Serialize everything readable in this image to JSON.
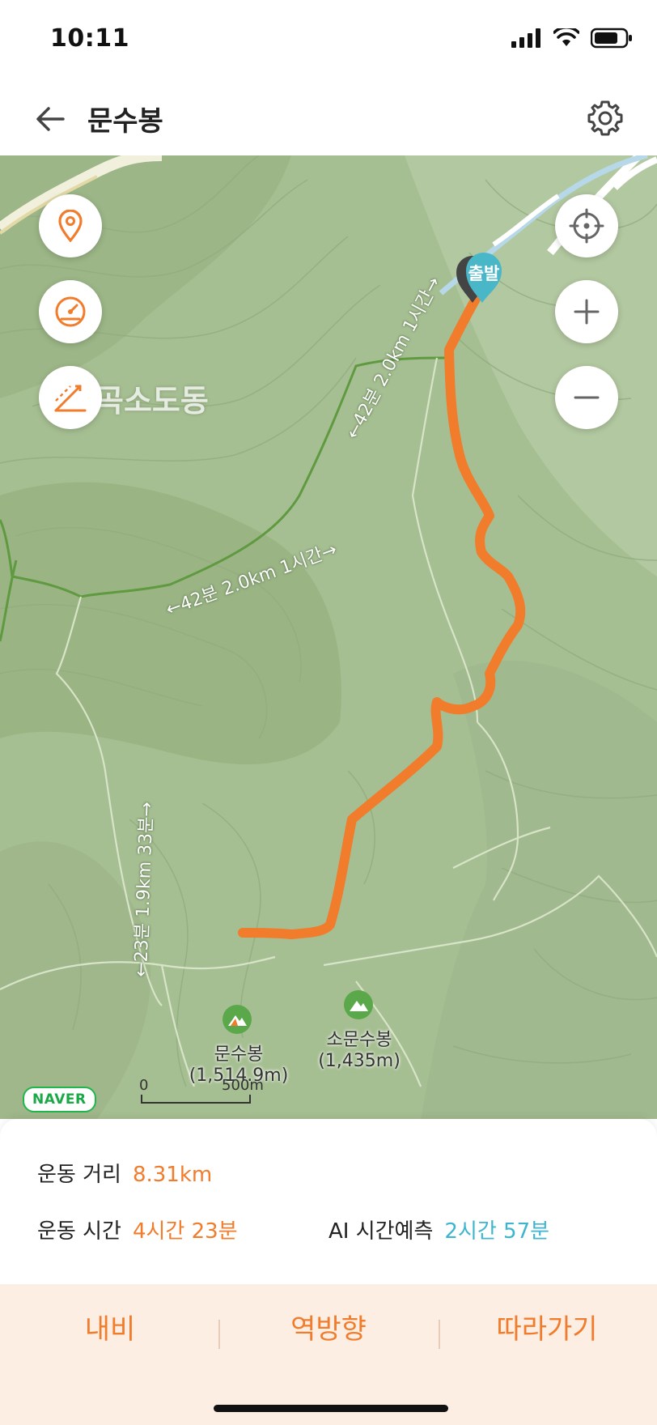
{
  "status": {
    "time": "10:11",
    "battery_level": 0.7
  },
  "header": {
    "title": "문수봉",
    "back_icon": "back-arrow-icon",
    "settings_icon": "gear-icon"
  },
  "map": {
    "controls": {
      "left": [
        "location-pin-icon",
        "speedometer-icon",
        "slope-icon"
      ],
      "right": [
        "locate-me-icon",
        "zoom-in-icon",
        "zoom-out-icon"
      ]
    },
    "area_label": "곡소도동",
    "start_marker": "출발",
    "trail_labels": [
      "←42분 2.0km 1시간→",
      "←42분 2.0km 1시간→",
      "←23분 1.9km 33분→"
    ],
    "peaks": [
      {
        "name": "문수봉",
        "elevation": "(1,514.9m)"
      },
      {
        "name": "소문수봉",
        "elevation": "(1,435m)"
      }
    ],
    "attribution": "NAVER",
    "scale": {
      "start": "0",
      "end": "500m"
    },
    "route_color": "#f07c2c"
  },
  "summary": {
    "distance_label": "운동 거리",
    "distance_value": "8.31km",
    "time_label": "운동 시간",
    "time_value": "4시간 23분",
    "ai_label": "AI 시간예측",
    "ai_value": "2시간 57분"
  },
  "actions": {
    "navigate": "내비",
    "reverse": "역방향",
    "follow": "따라가기"
  },
  "colors": {
    "accent": "#f07c2c",
    "ai": "#3eb5cf",
    "start_marker": "#4ab7c9",
    "peak": "#5aa84a"
  }
}
